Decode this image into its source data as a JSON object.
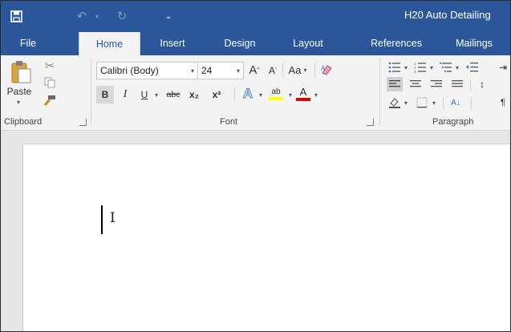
{
  "window": {
    "document_title": "H20 Auto Detailing",
    "quick_access": {
      "save_icon": "save-icon",
      "undo_icon": "undo-icon",
      "redo_icon": "redo-icon",
      "customize_icon": "customize-qat-icon"
    }
  },
  "tabs": [
    "File",
    "Home",
    "Insert",
    "Design",
    "Layout",
    "References",
    "Mailings"
  ],
  "active_tab": "Home",
  "ribbon": {
    "clipboard": {
      "paste_label": "Paste",
      "group_label": "Clipboard"
    },
    "font": {
      "font_name": "Calibri (Body)",
      "font_size": "24",
      "change_case_label": "Aa",
      "bold_label": "B",
      "italic_label": "I",
      "underline_label": "U",
      "strikethrough_label": "abc",
      "subscript_label": "x₂",
      "superscript_label": "x²",
      "text_effects_label": "A",
      "highlight_label": "ab",
      "font_color_label": "A",
      "grow_label": "A",
      "shrink_label": "A",
      "group_label": "Font"
    },
    "paragraph": {
      "group_label": "Paragraph",
      "sort_label": "A↓"
    }
  },
  "colors": {
    "brand": "#2b579a",
    "ribbon_bg": "#f3f3f3",
    "font_color_bar": "#e00000",
    "highlight_bar": "#ffff00",
    "text_effects": "#4a86c8"
  }
}
